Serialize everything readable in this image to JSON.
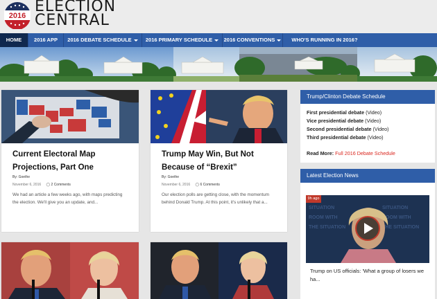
{
  "logo": {
    "year": "2016",
    "title_line1": "ELECTION",
    "title_line2": "CENTRAL"
  },
  "nav": {
    "items": [
      {
        "label": "HOME",
        "dropdown": false
      },
      {
        "label": "2016 APP",
        "dropdown": false
      },
      {
        "label": "2016 DEBATE SCHEDULE",
        "dropdown": true
      },
      {
        "label": "2016 PRIMARY SCHEDULE",
        "dropdown": true
      },
      {
        "label": "2016 CONVENTIONS",
        "dropdown": true
      },
      {
        "label": "WHO'S RUNNING IN 2016?",
        "dropdown": false
      }
    ]
  },
  "articles": [
    {
      "title": "Current Electoral Map Projections, Part One",
      "author": "By: Goethe",
      "date": "November 6, 2016",
      "comments": "2 Comments",
      "excerpt": "We had an article a few weeks ago, with maps predicting the election. We'll give you an update, and..."
    },
    {
      "title": "Trump May Win, But Not Because of “Brexit”",
      "author": "By: Goethe",
      "date": "November 6, 2016",
      "comments": "6 Comments",
      "excerpt": "Our election polls are getting close, with the momentum behind Donald Trump. At this point, it's unlikely that a..."
    }
  ],
  "sidebar": {
    "debate_widget": {
      "heading": "Trump/Clinton Debate Schedule",
      "rows": [
        {
          "label": "First presidential debate",
          "video": "(Video)"
        },
        {
          "label": "Vice presidential debate",
          "video": "(Video)"
        },
        {
          "label": "Second presidential debate",
          "video": "(Video)"
        },
        {
          "label": "Third presidential debate",
          "video": "(Video)"
        }
      ],
      "read_more_label": "Read More:",
      "read_more_link": "Full 2016 Debate Schedule"
    },
    "news_widget": {
      "heading": "Latest Election News",
      "time_badge": "9h ago",
      "caption": "Trump on US officials: 'What a group of losers we ha..."
    }
  },
  "colors": {
    "nav_blue": "#2f5ea8",
    "nav_active": "#10284e",
    "link_red": "#d9251d"
  }
}
